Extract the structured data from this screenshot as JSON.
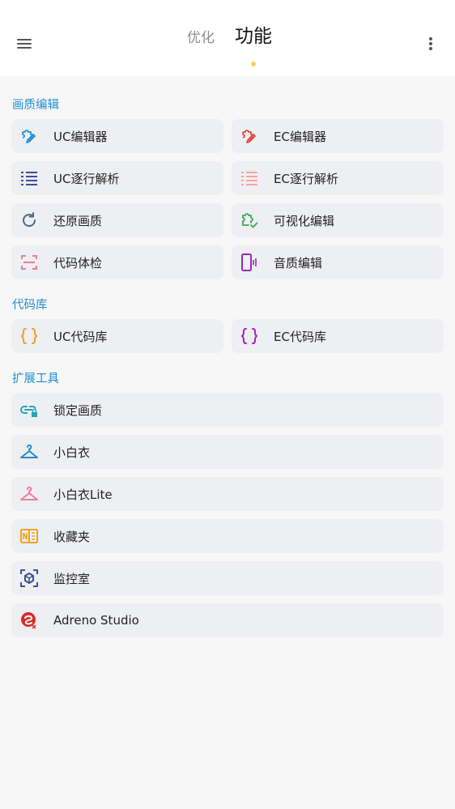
{
  "header": {
    "tabs": [
      {
        "label": "优化",
        "active": false
      },
      {
        "label": "功能",
        "active": true
      }
    ],
    "menu_icon": "hamburger-menu-icon",
    "more_icon": "more-vertical-icon",
    "indicator_color": "#f6d548"
  },
  "sections": [
    {
      "title": "画质编辑",
      "items": [
        {
          "label": "UC编辑器",
          "icon": "puzzle-edit-icon",
          "color": "#1f8fd0"
        },
        {
          "label": "EC编辑器",
          "icon": "puzzle-edit-icon",
          "color": "#e0483d"
        },
        {
          "label": "UC逐行解析",
          "icon": "list-icon",
          "color": "#3a5199"
        },
        {
          "label": "EC逐行解析",
          "icon": "list-icon",
          "color": "#f3a7a0"
        },
        {
          "label": "还原画质",
          "icon": "refresh-icon",
          "color": "#4a6b8a"
        },
        {
          "label": "可视化编辑",
          "icon": "puzzle-check-icon",
          "color": "#3aa655"
        },
        {
          "label": "代码体检",
          "icon": "scan-icon",
          "color": "#ee7e97"
        },
        {
          "label": "音质编辑",
          "icon": "phone-vibrate-icon",
          "color": "#9b2bb0"
        }
      ]
    },
    {
      "title": "代码库",
      "items": [
        {
          "label": "UC代码库",
          "icon": "braces-icon",
          "color": "#f2a21e"
        },
        {
          "label": "EC代码库",
          "icon": "braces-icon",
          "color": "#9b2bb0"
        }
      ]
    },
    {
      "title": "扩展工具",
      "items": [
        {
          "label": "锁定画质",
          "icon": "link-lock-icon",
          "color": "#22a4b8"
        },
        {
          "label": "小白衣",
          "icon": "hanger-icon",
          "color": "#1f8fd0"
        },
        {
          "label": "小白衣Lite",
          "icon": "hanger-icon",
          "color": "#ee7e97"
        },
        {
          "label": "收藏夹",
          "icon": "notebook-icon",
          "color": "#f2a21e"
        },
        {
          "label": "监控室",
          "icon": "cube-scan-icon",
          "color": "#3a5199"
        },
        {
          "label": "Adreno Studio",
          "icon": "adreno-logo-icon",
          "color": "#d92b2b"
        }
      ]
    }
  ]
}
